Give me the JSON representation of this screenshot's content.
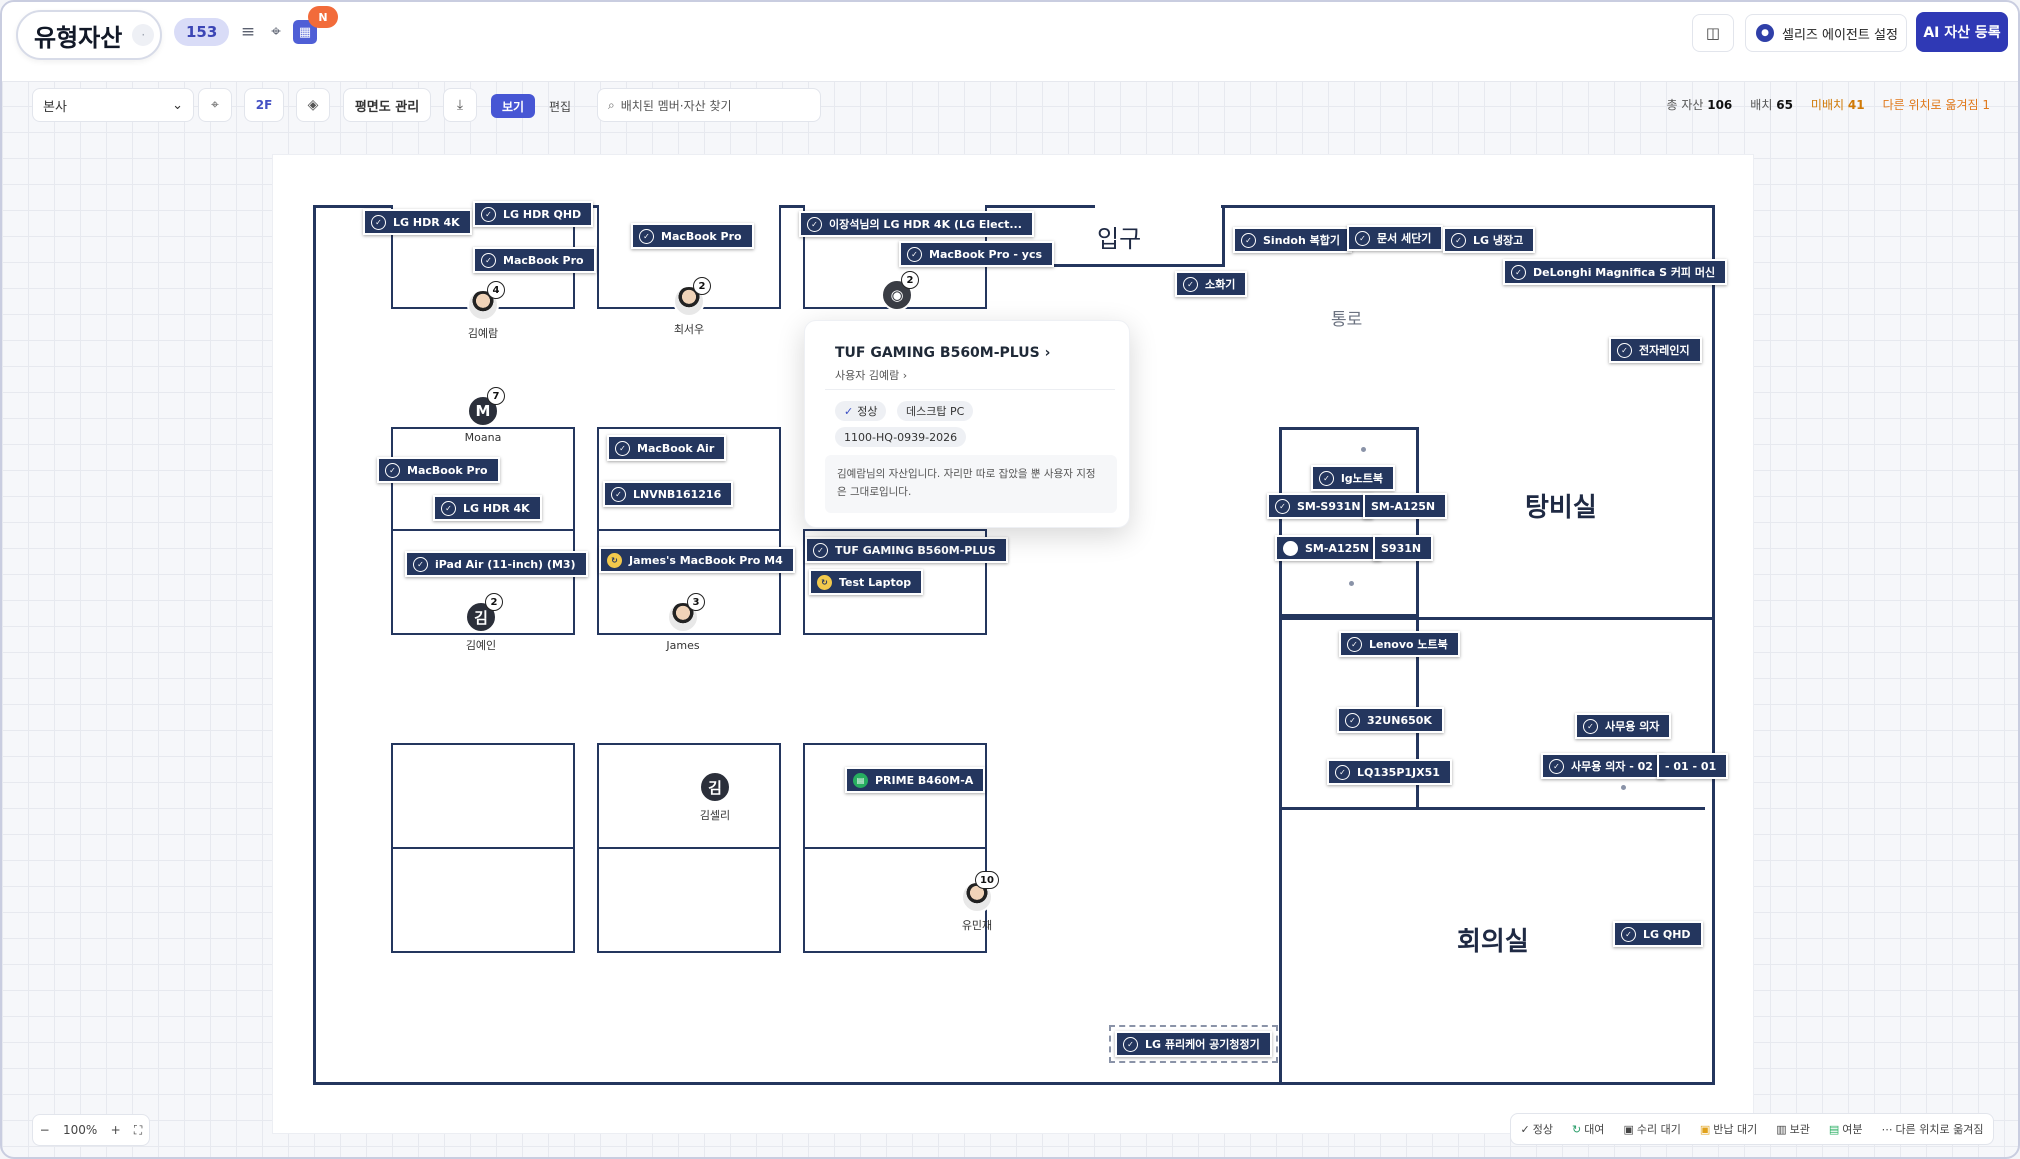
{
  "header": {
    "title": "유형자산",
    "title_dot": "·",
    "count": "153",
    "notification_badge": "N",
    "agent_button": "셀리즈 에이전트 설정",
    "ai_button": "AI 자산 등록"
  },
  "toolbar": {
    "location_select": "본사",
    "floor": "2F",
    "manage_button": "평면도 관리",
    "view_tab": "보기",
    "edit_tab": "편집",
    "search_placeholder": "배치된 멤버·자산 찾기",
    "stats": {
      "total_label": "총 자산",
      "total": "106",
      "placed_label": "배치",
      "placed": "65",
      "unplaced_label": "미배치",
      "unplaced": "41",
      "moved_label": "다른 위치로 옮겨짐",
      "moved": "1"
    }
  },
  "floorplan": {
    "rooms": {
      "entrance": "입구",
      "hallway": "통로",
      "pantry": "탕비실",
      "meeting": "회의실"
    },
    "tags": [
      {
        "label": "LG HDR 4K",
        "icon": "check"
      },
      {
        "label": "LG HDR QHD",
        "icon": "check"
      },
      {
        "label": "MacBook Pro",
        "icon": "check"
      },
      {
        "label": "MacBook Pro",
        "icon": "check"
      },
      {
        "label": "이장석님의 LG HDR 4K (LG Elect...",
        "icon": "check"
      },
      {
        "label": "MacBook Pro - ycs",
        "icon": "check"
      },
      {
        "label": "Sindoh 복합기",
        "icon": "check"
      },
      {
        "label": "문서 세단기",
        "icon": "check"
      },
      {
        "label": "LG 냉장고",
        "icon": "check"
      },
      {
        "label": "DeLonghi Magnifica S 커피 머신",
        "icon": "check"
      },
      {
        "label": "소화기",
        "icon": "check"
      },
      {
        "label": "전자레인지",
        "icon": "check"
      },
      {
        "label": "MacBook Pro",
        "icon": "check"
      },
      {
        "label": "LG HDR 4K",
        "icon": "check"
      },
      {
        "label": "iPad Air (11-inch) (M3)",
        "icon": "check"
      },
      {
        "label": "MacBook Air",
        "icon": "check"
      },
      {
        "label": "LNVNB161216",
        "icon": "check"
      },
      {
        "label": "James's MacBook Pro M4",
        "icon": "rent"
      },
      {
        "label": "TUF GAMING B560M-PLUS",
        "icon": "check"
      },
      {
        "label": "Test Laptop",
        "icon": "rent"
      },
      {
        "label": "lg노트북",
        "icon": "check"
      },
      {
        "label": "SM-S931N",
        "icon": "check"
      },
      {
        "label": "SM-A125N",
        "icon": "none"
      },
      {
        "label": "SM-A125N",
        "icon": "loading"
      },
      {
        "label": "S931N",
        "icon": "none"
      },
      {
        "label": "Lenovo 노트북",
        "icon": "check"
      },
      {
        "label": "32UN650K",
        "icon": "check"
      },
      {
        "label": "LQ135P1JX51",
        "icon": "check"
      },
      {
        "label": "사무용 의자",
        "icon": "check"
      },
      {
        "label": "사무용 의자 - 02",
        "icon": "check"
      },
      {
        "label": "- 01 - 01",
        "icon": "none"
      },
      {
        "label": "PRIME B460M-A",
        "icon": "spare"
      },
      {
        "label": "LG QHD",
        "icon": "check"
      },
      {
        "label": "LG 퓨리케어 공기청정기",
        "icon": "check"
      }
    ],
    "people": [
      {
        "name": "김예람",
        "badge": "4",
        "initial": ""
      },
      {
        "name": "최서우",
        "badge": "2",
        "initial": ""
      },
      {
        "name": "",
        "badge": "2",
        "initial": ""
      },
      {
        "name": "Moana",
        "badge": "7",
        "initial": "M"
      },
      {
        "name": "김예인",
        "badge": "2",
        "initial": "김"
      },
      {
        "name": "James",
        "badge": "3",
        "initial": ""
      },
      {
        "name": "김셀리",
        "badge": "",
        "initial": "김"
      },
      {
        "name": "유민재",
        "badge": "10",
        "initial": ""
      }
    ]
  },
  "popover": {
    "title": "TUF GAMING B560M-PLUS",
    "user": "사용자 김예람",
    "status": "정상",
    "category": "데스크탑 PC",
    "code": "1100-HQ-0939-2026",
    "description": "김예람님의 자산입니다. 자리만 따로 잡았을 뿐 사용자 지정은 그대로입니다."
  },
  "zoom": {
    "level": "100%"
  },
  "legend": [
    "정상",
    "대여",
    "수리 대기",
    "반납 대기",
    "보관",
    "여분",
    "다른 위치로 옮겨짐"
  ],
  "colors": {
    "accent": "#2f39b5",
    "tag_bg": "#24365e",
    "warn": "#d07a07"
  }
}
